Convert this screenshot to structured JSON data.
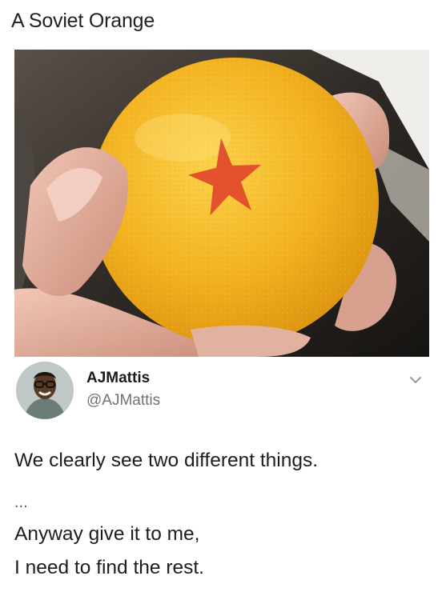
{
  "caption": "A Soviet Orange",
  "photo": {
    "subject": "orange-with-red-star",
    "colors": {
      "orange": "#f2b21e",
      "star": "#e0452a",
      "background": "#2a2623"
    }
  },
  "tweet": {
    "author": {
      "display_name": "AJMattis",
      "handle": "@AJMattis"
    },
    "chevron_icon": "chevron-down-icon",
    "lines": [
      "We clearly see two different things.",
      "...",
      "Anyway give it to me,",
      "I need to find the rest."
    ]
  }
}
